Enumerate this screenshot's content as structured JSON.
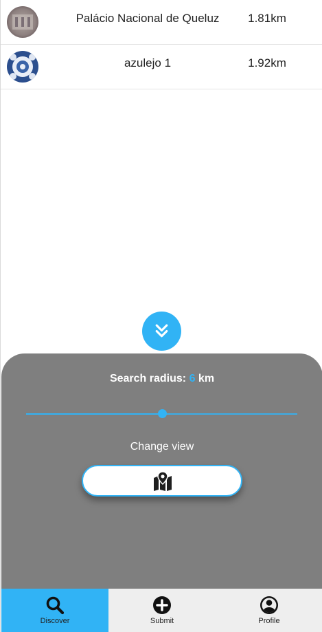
{
  "results": [
    {
      "name": "Palácio Nacional de Queluz",
      "distance": "1.81km",
      "thumbnail_icon": "palace-photo-thumbnail"
    },
    {
      "name": "azulejo 1",
      "distance": "1.92km",
      "thumbnail_icon": "azulejo-tile-thumbnail"
    }
  ],
  "toggle_icon": "double-chevron-down-icon",
  "sheet": {
    "radius_prefix": "Search radius:",
    "radius_value": "6",
    "radius_unit": "km",
    "slider_fraction": 0.5,
    "change_view_label": "Change view",
    "view_button_icon": "map-marker-icon"
  },
  "nav": {
    "items": [
      {
        "label": "Discover",
        "icon": "search-icon",
        "active": true
      },
      {
        "label": "Submit",
        "icon": "plus-circle-icon",
        "active": false
      },
      {
        "label": "Profile",
        "icon": "user-circle-icon",
        "active": false
      }
    ]
  },
  "colors": {
    "accent": "#31b3f5",
    "sheet": "#7f7f7f",
    "nav_bg": "#eeeeee"
  }
}
